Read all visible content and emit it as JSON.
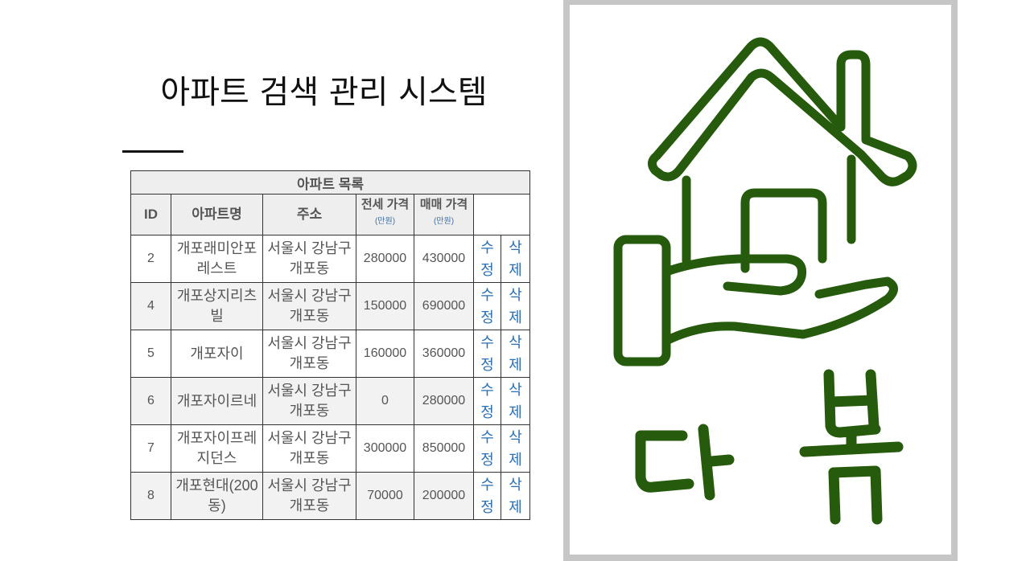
{
  "page": {
    "title": "아파트 검색 관리 시스템"
  },
  "table": {
    "caption": "아파트 목록",
    "headers": {
      "id": "ID",
      "name": "아파트명",
      "address": "주소",
      "jeonse": "전세 가격",
      "sale": "매매 가격",
      "unit": "(만원)"
    },
    "rows": [
      {
        "id": "2",
        "name": "개포래미안포레스트",
        "address": "서울시 강남구 개포동",
        "jeonse": "280000",
        "sale": "430000",
        "edit": "수정",
        "delete": "삭제"
      },
      {
        "id": "4",
        "name": "개포상지리츠빌",
        "address": "서울시 강남구 개포동",
        "jeonse": "150000",
        "sale": "690000",
        "edit": "수정",
        "delete": "삭제"
      },
      {
        "id": "5",
        "name": "개포자이",
        "address": "서울시 강남구 개포동",
        "jeonse": "160000",
        "sale": "360000",
        "edit": "수정",
        "delete": "삭제"
      },
      {
        "id": "6",
        "name": "개포자이르네",
        "address": "서울시 강남구 개포동",
        "jeonse": "0",
        "sale": "280000",
        "edit": "수정",
        "delete": "삭제"
      },
      {
        "id": "7",
        "name": "개포자이프레지던스",
        "address": "서울시 강남구 개포동",
        "jeonse": "300000",
        "sale": "850000",
        "edit": "수정",
        "delete": "삭제"
      },
      {
        "id": "8",
        "name": "개포현대(200동)",
        "address": "서울시 강남구 개포동",
        "jeonse": "70000",
        "sale": "200000",
        "edit": "수정",
        "delete": "삭제"
      }
    ]
  },
  "logo": {
    "icon": "house-on-hand-icon",
    "text": "다봄",
    "color": "#265a0c",
    "frame_color": "#c6c6c6"
  }
}
